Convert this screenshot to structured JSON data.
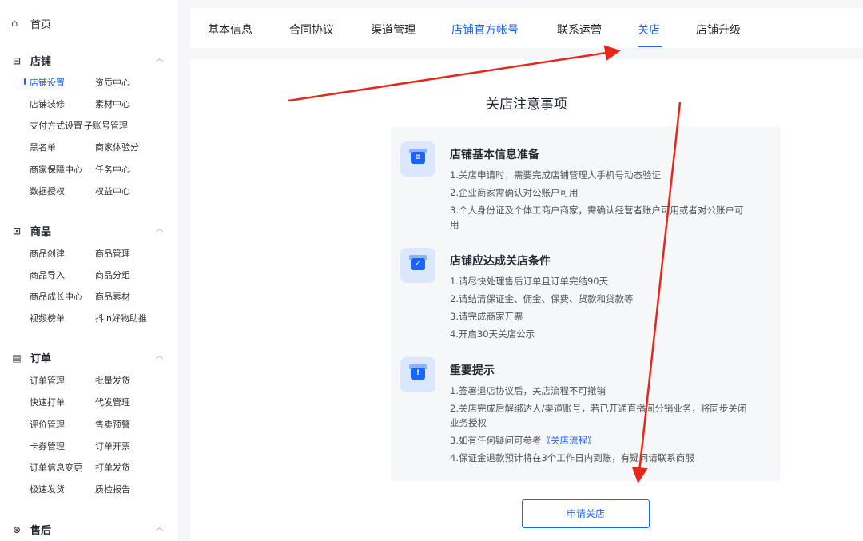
{
  "sidebar": {
    "home": "首页",
    "sections": [
      {
        "title": "店铺",
        "items": [
          [
            "店铺设置",
            "资质中心"
          ],
          [
            "店铺装修",
            "素材中心"
          ],
          [
            "支付方式设置",
            "子账号管理"
          ],
          [
            "黑名单",
            "商家体验分"
          ],
          [
            "商家保障中心",
            "任务中心"
          ],
          [
            "数据授权",
            "权益中心"
          ]
        ]
      },
      {
        "title": "商品",
        "items": [
          [
            "商品创建",
            "商品管理"
          ],
          [
            "商品导入",
            "商品分组"
          ],
          [
            "商品成长中心",
            "商品素材"
          ],
          [
            "视频榜单",
            "抖in好物助推"
          ]
        ]
      },
      {
        "title": "订单",
        "items": [
          [
            "订单管理",
            "批量发货"
          ],
          [
            "快速打单",
            "代发管理"
          ],
          [
            "评价管理",
            "售卖预警"
          ],
          [
            "卡券管理",
            "订单开票"
          ],
          [
            "订单信息变更",
            "打单发货"
          ],
          [
            "极速发货",
            "质检报告"
          ]
        ]
      },
      {
        "title": "售后",
        "items": []
      }
    ],
    "active_item": "店铺设置"
  },
  "tabs": [
    "基本信息",
    "合同协议",
    "渠道管理",
    "店铺官方帐号",
    "联系运营",
    "关店",
    "店铺升级"
  ],
  "panel": {
    "title": "关店注意事项",
    "groups": [
      {
        "icon": "store-list-icon",
        "title": "店铺基本信息准备",
        "lines": [
          "1.关店申请时，需要完成店铺管理人手机号动态验证",
          "2.企业商家需确认对公账户可用",
          "3.个人身份证及个体工商户商家，需确认经营者账户可用或者对公账户可用"
        ]
      },
      {
        "icon": "store-check-icon",
        "title": "店铺应达成关店条件",
        "lines": [
          "1.请尽快处理售后订单且订单完结90天",
          "2.请结清保证金、佣金、保费、货款和贷款等",
          "3.请完成商家开票",
          "4.开启30天关店公示"
        ]
      },
      {
        "icon": "store-alert-icon",
        "title": "重要提示",
        "lines": [
          "1.签署退店协议后，关店流程不可撤销",
          "2.关店完成后解绑达人/渠道账号，若已开通直播间分销业务，将同步关闭业务授权",
          "3.如有任何疑问可参考",
          "4.保证金退款预计将在3个工作日内到账，有疑问请联系商服"
        ],
        "link_text": "《关店流程》"
      }
    ],
    "apply_button": "申请关店"
  },
  "colors": {
    "accent": "#1966ff",
    "annotation": "#e8261c"
  }
}
